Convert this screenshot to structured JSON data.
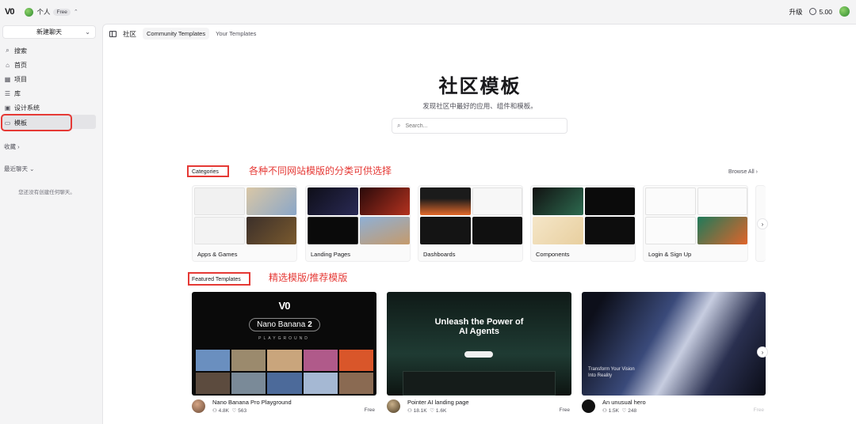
{
  "topbar": {
    "logo": "V0",
    "workspace": "个人",
    "plan_badge": "Free",
    "upgrade": "升级",
    "credits": "5.00"
  },
  "sidebar": {
    "new_chat": "新建聊天",
    "items": [
      {
        "label": "搜索",
        "icon": "search-icon"
      },
      {
        "label": "首页",
        "icon": "home-icon"
      },
      {
        "label": "项目",
        "icon": "grid-icon"
      },
      {
        "label": "库",
        "icon": "list-icon"
      },
      {
        "label": "设计系统",
        "icon": "design-system-icon"
      },
      {
        "label": "模板",
        "icon": "template-icon"
      }
    ],
    "favorites": "收藏",
    "recent_chats": "最近聊天",
    "empty_text": "您还没有创建任何聊天。"
  },
  "tabs": {
    "crumb": "社区",
    "active": "Community Templates",
    "other": "Your Templates"
  },
  "hero": {
    "title": "社区模板",
    "subtitle": "发现社区中最好的应用、组件和模板。",
    "search_placeholder": "Search..."
  },
  "categories": {
    "label": "Categories",
    "annotation": "各种不同网站模版的分类可供选择",
    "browse_all": "Browse All",
    "items": [
      {
        "label": "Apps & Games"
      },
      {
        "label": "Landing Pages"
      },
      {
        "label": "Dashboards"
      },
      {
        "label": "Components"
      },
      {
        "label": "Login & Sign Up"
      }
    ]
  },
  "featured": {
    "label": "Featured Templates",
    "annotation": "精选模版/推荐模版",
    "items": [
      {
        "title": "Nano Banana Pro Playground",
        "views": "4.8K",
        "likes": "563",
        "price": "Free",
        "thumb_logo": "V0",
        "thumb_title": "Nano Banana",
        "thumb_num": "2",
        "thumb_sub": "PLAYGROUND"
      },
      {
        "title": "Pointer AI landing page",
        "views": "18.1K",
        "likes": "1.6K",
        "price": "Free",
        "thumb_title": "Unleash the Power of AI Agents"
      },
      {
        "title": "An unusual hero",
        "views": "1.5K",
        "likes": "248",
        "price": "Free",
        "thumb_title": "Transform Your Vision Into Reality"
      }
    ]
  },
  "colors": {
    "annotation_red": "#e53935",
    "accent_green": "#4caf50"
  }
}
